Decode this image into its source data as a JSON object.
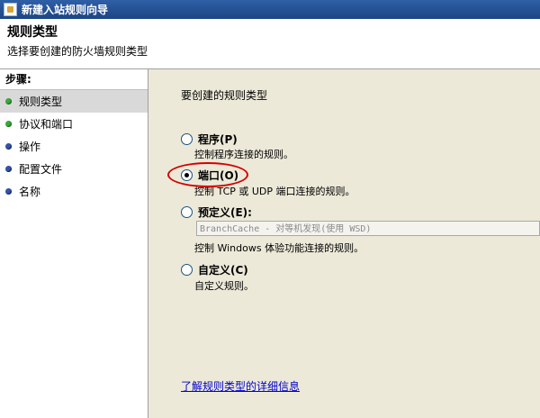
{
  "window": {
    "title": "新建入站规则向导",
    "app_icon": "wizard-icon"
  },
  "header": {
    "title": "规则类型",
    "subtitle": "选择要创建的防火墙规则类型"
  },
  "steps": {
    "heading": "步骤:",
    "items": [
      {
        "label": "规则类型",
        "status": "green",
        "active": true
      },
      {
        "label": "协议和端口",
        "status": "green",
        "active": false
      },
      {
        "label": "操作",
        "status": "blue",
        "active": false
      },
      {
        "label": "配置文件",
        "status": "blue",
        "active": false
      },
      {
        "label": "名称",
        "status": "blue",
        "active": false
      }
    ]
  },
  "main": {
    "prompt": "要创建的规则类型",
    "options": [
      {
        "label": "程序(P)",
        "desc": "控制程序连接的规则。",
        "checked": false
      },
      {
        "label": "端口(O)",
        "desc": "控制 TCP 或 UDP 端口连接的规则。",
        "checked": true
      },
      {
        "label": "预定义(E):",
        "desc": "控制 Windows 体验功能连接的规则。",
        "checked": false
      },
      {
        "label": "自定义(C)",
        "desc": "自定义规则。",
        "checked": false
      }
    ],
    "predefined_select_value": "BranchCache - 对等机发现(使用 WSD)",
    "learn_more_link": "了解规则类型的详细信息"
  },
  "colors": {
    "titlebar": "#1c4584",
    "panel_bg": "#ece9d8",
    "active_step": "#d9d9d9",
    "highlight": "#d40000",
    "link": "#0000cc"
  }
}
